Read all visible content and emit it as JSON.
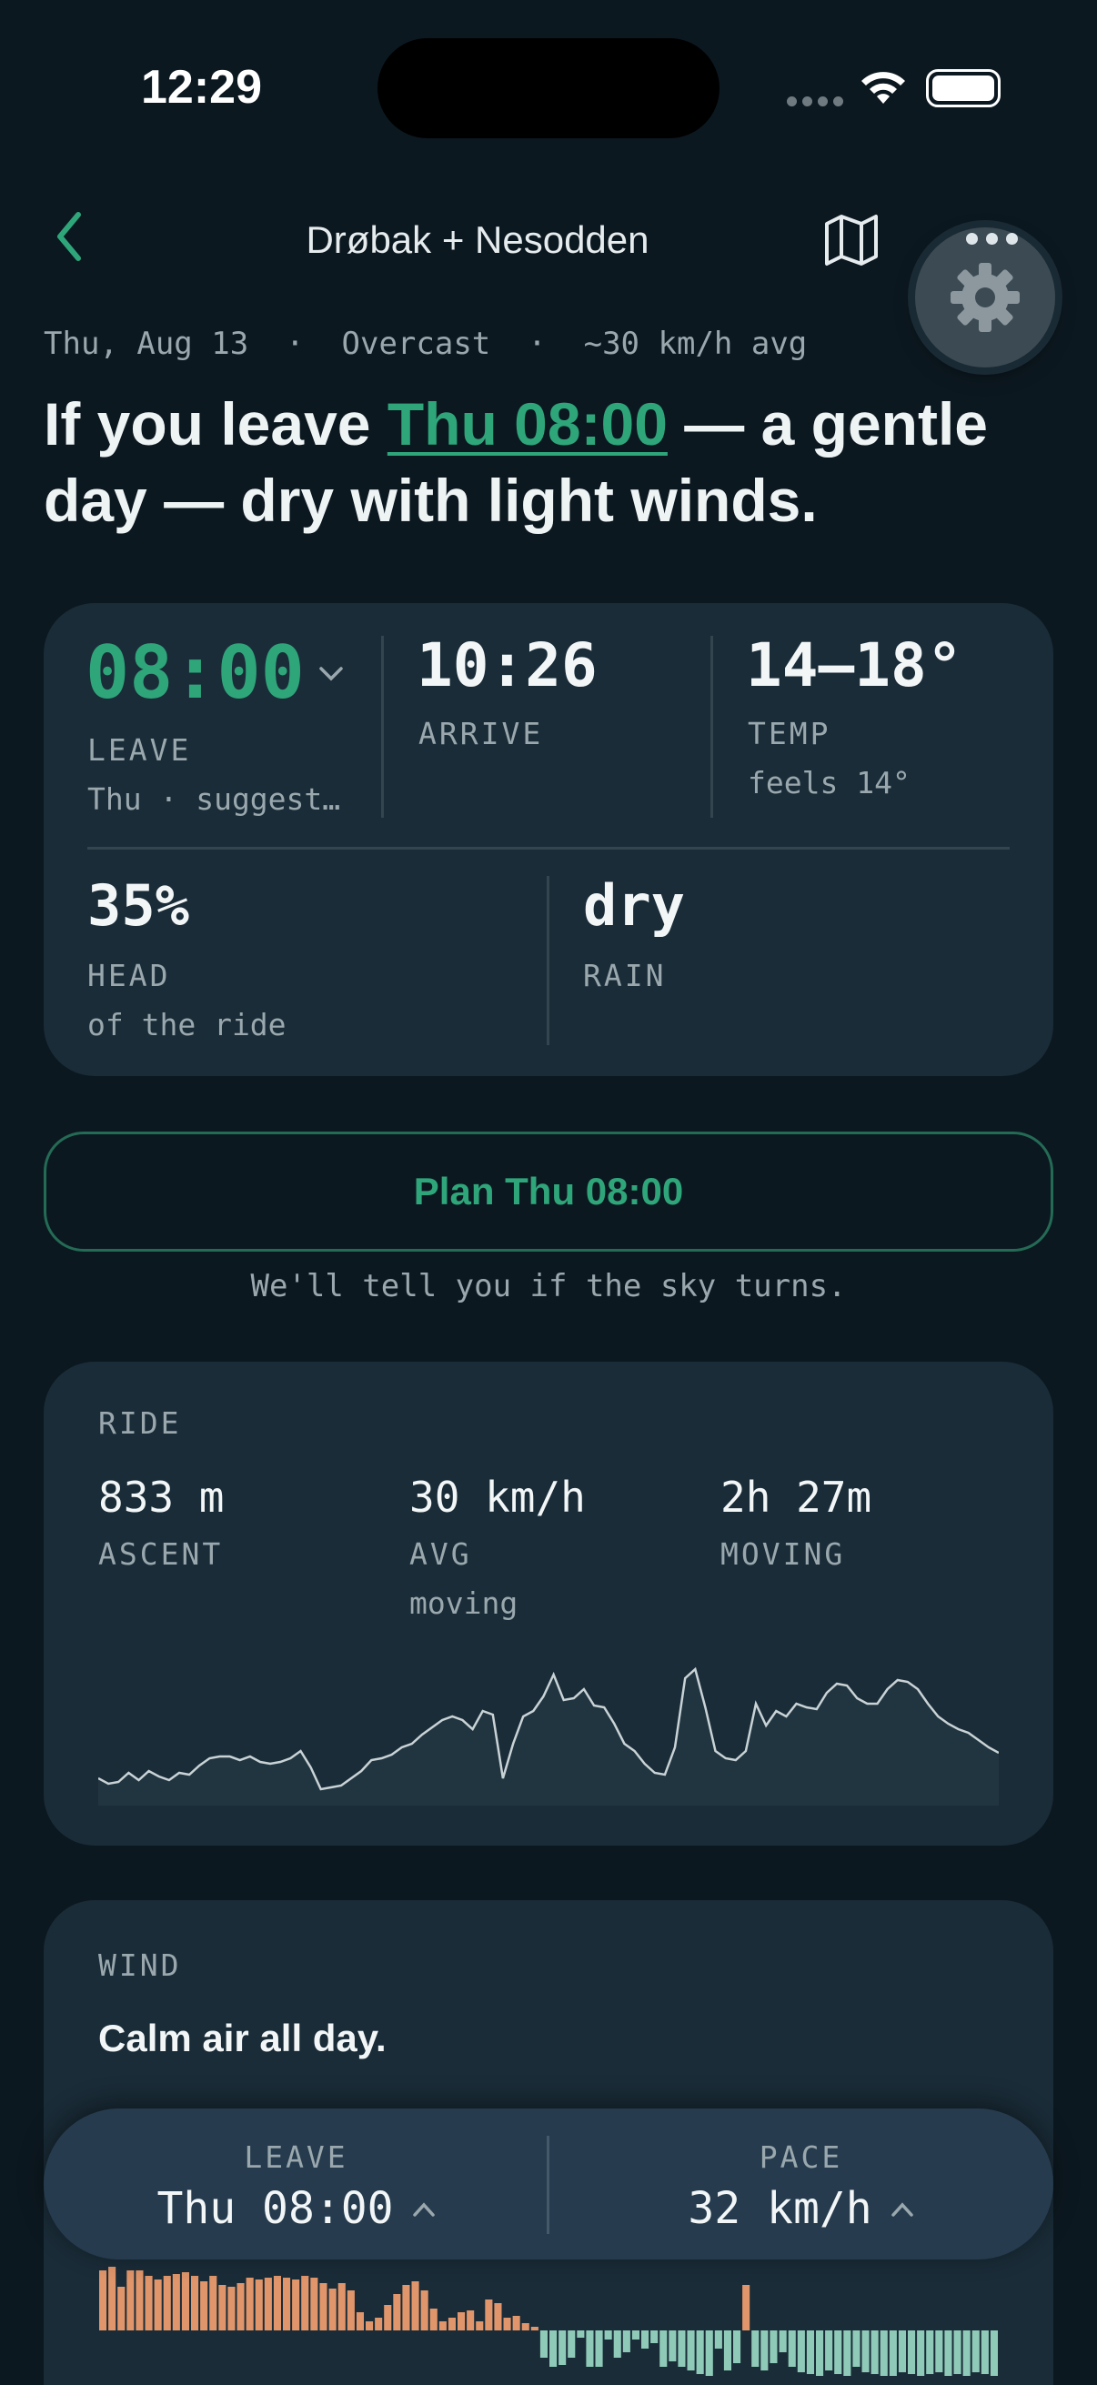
{
  "status": {
    "time": "12:29"
  },
  "nav": {
    "title": "Drøbak + Nesodden"
  },
  "summary": {
    "meta": "Thu, Aug 13  ·  Overcast  ·  ~30 km/h avg",
    "headline_pre": "If you leave ",
    "headline_link": "Thu 08:00",
    "headline_post": " — a gentle day — dry with light winds."
  },
  "forecast": {
    "leave": {
      "value": "08:00",
      "label": "LEAVE",
      "sub": "Thu · suggest…"
    },
    "arrive": {
      "value": "10:26",
      "label": "ARRIVE"
    },
    "temp": {
      "value": "14–18°",
      "label": "TEMP",
      "sub": "feels 14°"
    },
    "head": {
      "value": "35%",
      "label": "HEAD",
      "sub": "of the ride"
    },
    "rain": {
      "value": "dry",
      "label": "RAIN"
    }
  },
  "plan": {
    "button": "Plan Thu 08:00",
    "note": "We'll tell you if the sky turns."
  },
  "ride": {
    "section": "RIDE",
    "ascent": {
      "value": "833 m",
      "label": "ASCENT"
    },
    "avg": {
      "value": "30 km/h",
      "label": "AVG",
      "sub": "moving"
    },
    "moving": {
      "value": "2h 27m",
      "label": "MOVING"
    },
    "elevation_profile": [
      22,
      16,
      18,
      28,
      20,
      30,
      24,
      20,
      28,
      26,
      36,
      44,
      46,
      46,
      42,
      46,
      40,
      38,
      40,
      44,
      52,
      34,
      10,
      12,
      14,
      22,
      30,
      42,
      44,
      48,
      56,
      60,
      70,
      78,
      86,
      90,
      86,
      76,
      96,
      92,
      22,
      60,
      90,
      96,
      112,
      136,
      108,
      110,
      120,
      102,
      100,
      82,
      60,
      52,
      38,
      28,
      26,
      56,
      132,
      142,
      100,
      52,
      44,
      42,
      52,
      104,
      80,
      96,
      90,
      104,
      100,
      98,
      116,
      126,
      124,
      110,
      104,
      104,
      120,
      130,
      128,
      120,
      104,
      90,
      82,
      76,
      72,
      64,
      56,
      50
    ]
  },
  "wind": {
    "section": "WIND",
    "text": "Calm air all day.",
    "bars": [
      66,
      70,
      48,
      66,
      66,
      60,
      56,
      60,
      62,
      64,
      60,
      54,
      60,
      50,
      48,
      52,
      58,
      56,
      58,
      60,
      58,
      56,
      60,
      58,
      52,
      46,
      52,
      44,
      20,
      10,
      14,
      28,
      40,
      50,
      54,
      44,
      24,
      10,
      14,
      20,
      22,
      10,
      34,
      30,
      14,
      16,
      8,
      4,
      -30,
      -40,
      -38,
      -30,
      -8,
      -40,
      -40,
      -10,
      -30,
      -24,
      -10,
      -20,
      -14,
      -40,
      -34,
      -40,
      -44,
      -48,
      -50,
      -20,
      -44,
      -36,
      50,
      -40,
      -44,
      -36,
      -24,
      -40,
      -46,
      -48,
      -50,
      -44,
      -48,
      -50,
      -40,
      -46,
      -48,
      -50,
      -50,
      -46,
      -48,
      -50,
      -48,
      -46,
      -50,
      -48,
      -50,
      -46,
      -48,
      -50
    ],
    "color_tail": "#e0956a",
    "color_head": "#8fcab8"
  },
  "controls": {
    "leave": {
      "label": "LEAVE",
      "value": "Thu 08:00"
    },
    "pace": {
      "label": "PACE",
      "value": "32 km/h"
    }
  },
  "colors": {
    "accent": "#2fa57a",
    "background": "#0c1820",
    "card": "#1a2c38"
  },
  "icons": [
    "chevron-left-icon",
    "map-icon",
    "gear-icon",
    "chevron-down-icon",
    "chevron-up-icon",
    "wifi-icon",
    "battery-icon"
  ]
}
